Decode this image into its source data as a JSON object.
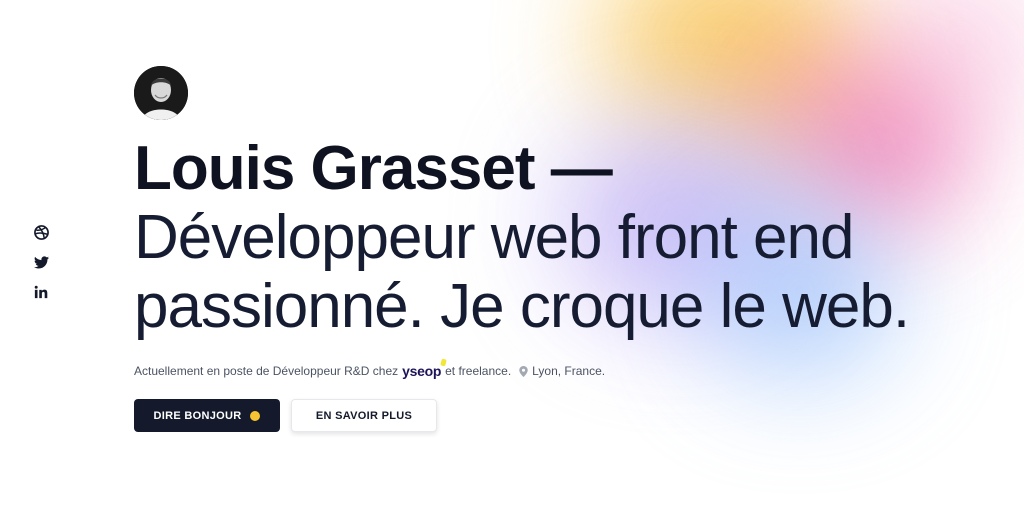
{
  "colors": {
    "text": "#141a2b",
    "primary_button": "#141a2b",
    "muted": "#4b5363",
    "brand": "#1d1457",
    "brand_accent": "#f3e63a"
  },
  "social": [
    {
      "name": "dribbble",
      "icon": "dribbble-icon"
    },
    {
      "name": "twitter",
      "icon": "twitter-icon"
    },
    {
      "name": "linkedin",
      "icon": "linkedin-icon"
    }
  ],
  "hero": {
    "headline_name": "Louis Grasset —",
    "headline_rest": "Développeur web front end passionné. Je croque le web.",
    "subline_prefix": "Actuellement en poste de Développeur R&D chez",
    "brand": "yseop",
    "subline_suffix": "et freelance.",
    "location": "Lyon, France."
  },
  "buttons": {
    "primary_label": "DIRE BONJOUR",
    "primary_emoji": "smiley-emoji",
    "secondary_label": "EN SAVOIR PLUS"
  }
}
